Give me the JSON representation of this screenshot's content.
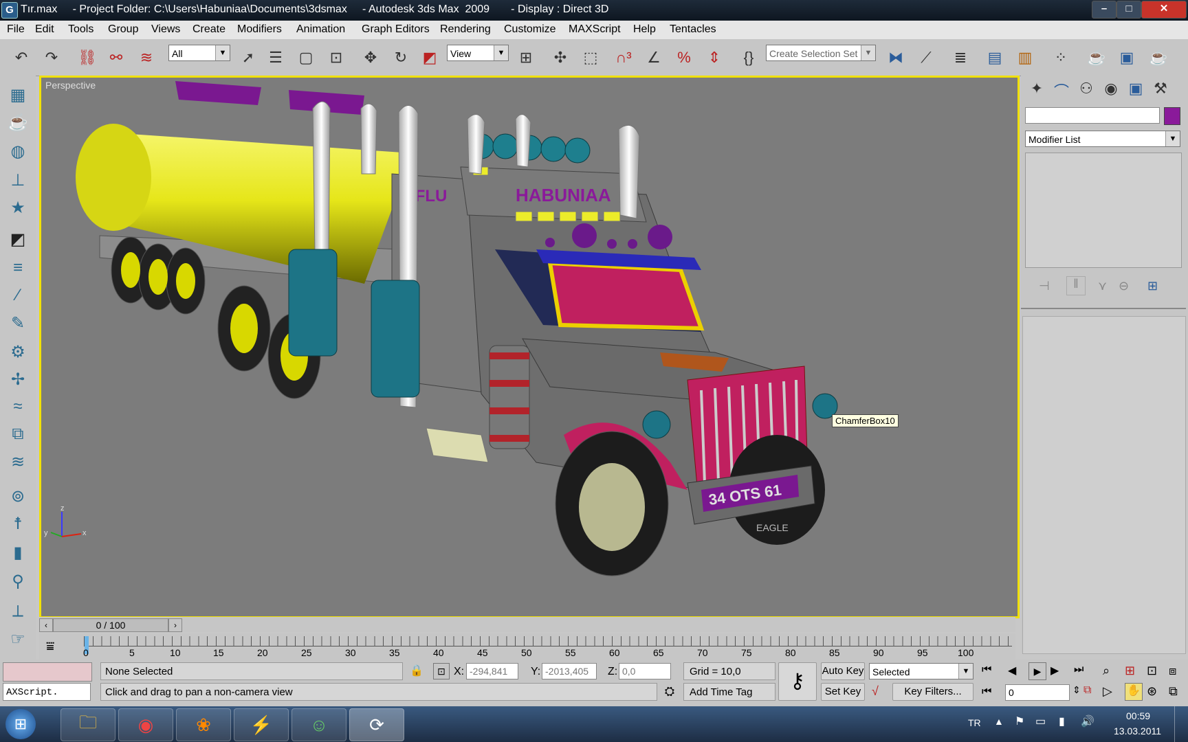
{
  "window": {
    "title": "Tır.max     - Project Folder: C:\\Users\\Habuniaa\\Documents\\3dsmax     - Autodesk 3ds Max  2009       - Display : Direct 3D",
    "app_icon": "3ds-max-icon",
    "controls": {
      "minimize": "–",
      "maximize": "□",
      "close": "✕"
    }
  },
  "menu": [
    "File",
    "Edit",
    "Tools",
    "Group",
    "Views",
    "Create",
    "Modifiers",
    "Animation",
    "Graph Editors",
    "Rendering",
    "Customize",
    "MAXScript",
    "Help",
    "Tentacles"
  ],
  "toolbar": {
    "selection_filter": "All",
    "reference_coord": "View",
    "named_selection_placeholder": "Create Selection Set",
    "icons": [
      "undo-icon",
      "redo-icon",
      "select-link-icon",
      "unlink-icon",
      "bind-space-warp-icon",
      "select-object-icon",
      "select-by-name-icon",
      "rect-region-icon",
      "window-crossing-icon",
      "move-icon",
      "rotate-icon",
      "scale-icon",
      "pivot-icon",
      "manipulate-icon",
      "keyboard-shortcut-icon",
      "snap-3-icon",
      "angle-snap-icon",
      "percent-snap-icon",
      "spinner-snap-icon",
      "edit-named-sets-icon",
      "mirror-icon",
      "align-icon",
      "layer-manager-icon",
      "curve-editor-icon",
      "schematic-view-icon",
      "material-editor-icon",
      "render-setup-icon",
      "render-frame-icon",
      "quick-render-icon"
    ]
  },
  "viewport": {
    "label": "Perspective",
    "tooltip": "ChamferBox10",
    "truck_logo": "HABUNIAA",
    "plate": "34 OTS 61",
    "side_text": "OFLU",
    "tire_text": "EAGLE",
    "axis_labels": {
      "x": "x",
      "y": "y",
      "z": "z"
    },
    "colors": {
      "background": "#7c7c7c",
      "border": "#f0e000",
      "tank": "#e6e619",
      "cab": "#6e6e6e",
      "accent": "#c01c6a"
    }
  },
  "command_panel": {
    "tabs": [
      "create-tab-icon",
      "modify-tab-icon",
      "hierarchy-tab-icon",
      "motion-tab-icon",
      "display-tab-icon",
      "utilities-tab-icon"
    ],
    "name_field": "",
    "object_color": "#8a1a9a",
    "modifier_list": "Modifier List"
  },
  "time_slider": {
    "label": "0 / 100"
  },
  "track_ticks": [
    "0",
    "5",
    "10",
    "15",
    "20",
    "25",
    "30",
    "35",
    "40",
    "45",
    "50",
    "55",
    "60",
    "65",
    "70",
    "75",
    "80",
    "85",
    "90",
    "95",
    "100"
  ],
  "status": {
    "maxscript": "AXScript.",
    "selection": "None Selected",
    "prompt": "Click and drag to pan a non-camera view",
    "x_label": "X:",
    "x_value": "-294,841",
    "y_label": "Y:",
    "y_value": "-2013,405",
    "z_label": "Z:",
    "z_value": "0,0",
    "grid": "Grid = 10,0",
    "add_time_tag": "Add Time Tag",
    "auto_key": "Auto Key",
    "set_key": "Set Key",
    "key_mode": "Selected",
    "key_filters": "Key Filters...",
    "frame": "0"
  },
  "taskbar": {
    "lang": "TR",
    "time": "00:59",
    "date": "13.03.2011"
  }
}
